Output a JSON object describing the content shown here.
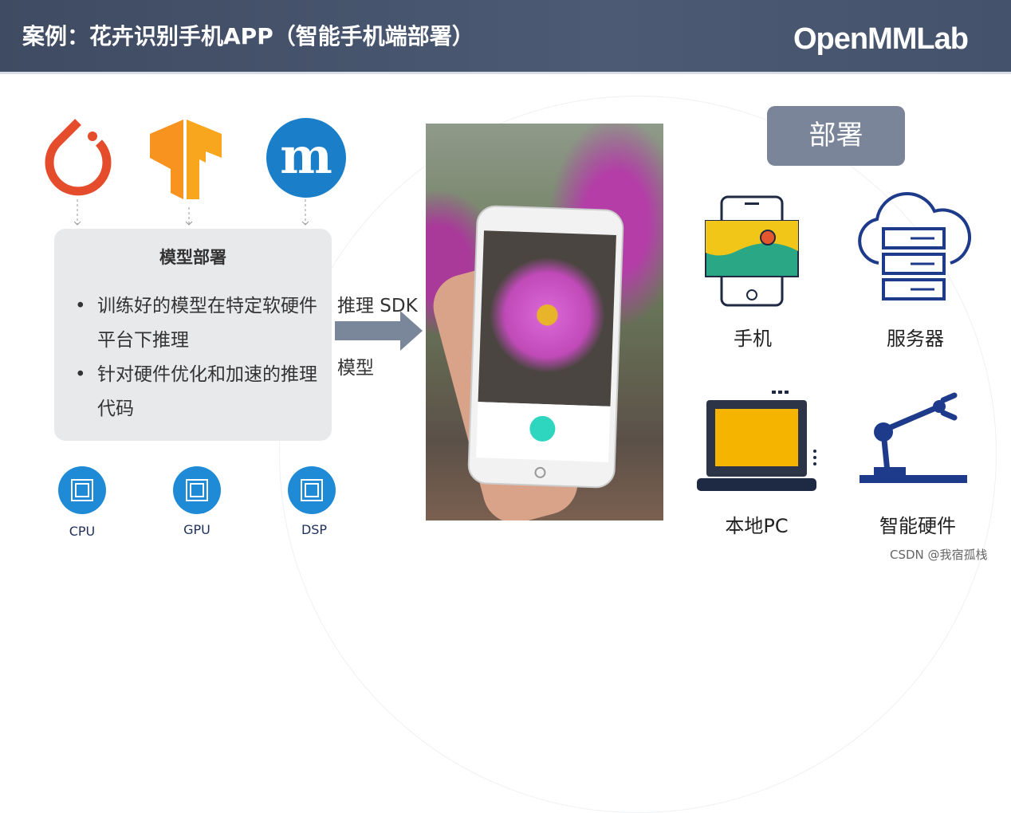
{
  "header": {
    "title": "案例：花卉识别手机APP（智能手机端部署）",
    "logo": "OpenMMLab"
  },
  "frameworks": [
    "pytorch-icon",
    "tensorflow-icon",
    "mxnet-icon"
  ],
  "model_box": {
    "title": "模型部署",
    "bullets": [
      "训练好的模型在特定软硬件平台下推理",
      "针对硬件优化和加速的推理代码"
    ]
  },
  "hardware": [
    {
      "label": "CPU"
    },
    {
      "label": "GPU"
    },
    {
      "label": "DSP"
    }
  ],
  "arrow": {
    "top_label": "推理 SDK",
    "bottom_label": "模型"
  },
  "deploy": {
    "button": "部署",
    "targets": [
      {
        "label": "手机",
        "icon": "smartphone-icon"
      },
      {
        "label": "服务器",
        "icon": "cloud-server-icon"
      },
      {
        "label": "本地PC",
        "icon": "laptop-icon"
      },
      {
        "label": "智能硬件",
        "icon": "robot-arm-icon"
      }
    ]
  },
  "colors": {
    "header": "#475369",
    "accent_blue": "#1f8ad6",
    "pytorch": "#e44c2c",
    "tensorflow": "#f7931e",
    "deploy_button": "#7b859a"
  },
  "watermark": "CSDN @我宿孤栈"
}
